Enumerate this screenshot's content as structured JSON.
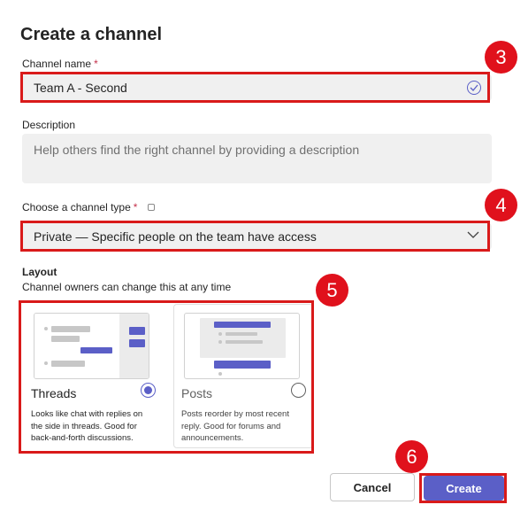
{
  "dialog": {
    "title": "Create a channel"
  },
  "channel_name": {
    "label": "Channel name",
    "required_marker": "*",
    "value": "Team A - Second",
    "status_icon": "check-circle-icon"
  },
  "description": {
    "label": "Description",
    "placeholder": "Help others find the right channel by providing a description"
  },
  "channel_type": {
    "label": "Choose a channel type",
    "required_marker": "*",
    "info_icon": "info-icon",
    "selected": "Private — Specific people on the team have access",
    "dropdown_icon": "chevron-down-icon"
  },
  "layout": {
    "title": "Layout",
    "subtitle": "Channel owners can change this at any time",
    "options": [
      {
        "name": "Threads",
        "description": "Looks like chat with replies on the side in threads. Good for back-and-forth discussions.",
        "selected": true
      },
      {
        "name": "Posts",
        "description": "Posts reorder by most recent reply. Good for forums and announcements.",
        "selected": false
      }
    ]
  },
  "buttons": {
    "cancel": "Cancel",
    "create": "Create"
  },
  "annotations": {
    "badges": [
      "3",
      "4",
      "5",
      "6"
    ],
    "color": "#e0111c"
  },
  "colors": {
    "accent": "#5b5fc7",
    "field_bg": "#f0f0f0",
    "required": "#c4314b",
    "highlight": "#d91a1a"
  }
}
